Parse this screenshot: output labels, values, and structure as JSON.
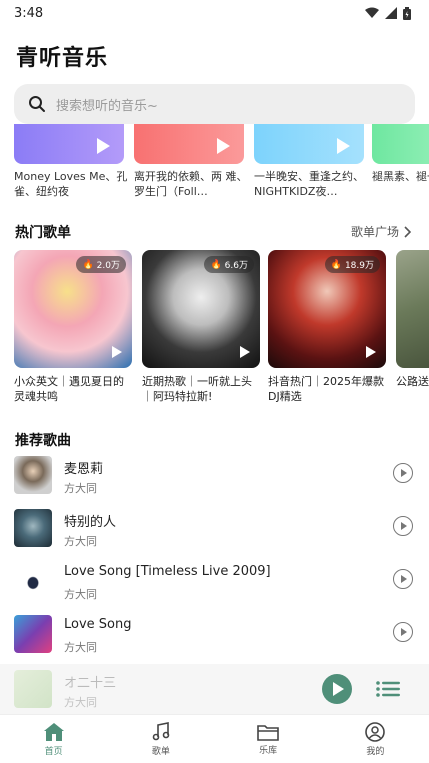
{
  "status": {
    "time": "3:48"
  },
  "app": {
    "title": "青听音乐"
  },
  "search": {
    "placeholder": "搜索想听的音乐~"
  },
  "banners": [
    {
      "title": "Money Loves Me、孔雀、纽约夜",
      "color": "#a78bfa"
    },
    {
      "title": "离开我的依赖、两 难、罗生门（Foll…",
      "color": "#f87171"
    },
    {
      "title": "一半晚安、重逢之约、NIGHTKIDZ夜…",
      "color": "#7dd3fc"
    },
    {
      "title": "褪黑素、褪一半晚安",
      "color": "#86efac"
    }
  ],
  "hot": {
    "heading": "热门歌单",
    "more": "歌单广场",
    "items": [
      {
        "count": "2.0万",
        "title": "小众英文｜遇见夏日的灵魂共鸣",
        "colors": [
          "#f4a6b5",
          "#e8d86a",
          "#2b6fb0"
        ]
      },
      {
        "count": "6.6万",
        "title": "近期热歌｜一听就上头｜阿玛特拉斯!",
        "colors": [
          "#d9d9d9",
          "#444",
          "#111"
        ]
      },
      {
        "count": "18.9万",
        "title": "抖音热门｜2025年爆款DJ精选",
        "colors": [
          "#c0392b",
          "#2b1a1a",
          "#7a1010"
        ]
      },
      {
        "count": "",
        "title": "公路送烦",
        "colors": [
          "#6b7a5a",
          "#3a4430",
          "#9aa38a"
        ]
      }
    ]
  },
  "recommend": {
    "heading": "推荐歌曲",
    "songs": [
      {
        "name": "麦恩莉",
        "artist": "方大同",
        "colors": [
          "#cfcfcf",
          "#2a2a2a"
        ]
      },
      {
        "name": "特别的人",
        "artist": "方大同",
        "colors": [
          "#4b6b7a",
          "#1c2a33"
        ]
      },
      {
        "name": "Love Song [Timeless Live 2009]",
        "artist": "方大同",
        "colors": [
          "#ffffff",
          "#202a44"
        ]
      },
      {
        "name": "Love Song",
        "artist": "方大同",
        "colors": [
          "#3aa0d8",
          "#e04080"
        ]
      }
    ]
  },
  "player": {
    "name": "オ二十三",
    "artist": "方大同"
  },
  "tabs": [
    {
      "label": "首页",
      "active": true
    },
    {
      "label": "歌单",
      "active": false
    },
    {
      "label": "乐库",
      "active": false
    },
    {
      "label": "我的",
      "active": false
    }
  ],
  "colors": {
    "accent": "#4f8f79"
  }
}
